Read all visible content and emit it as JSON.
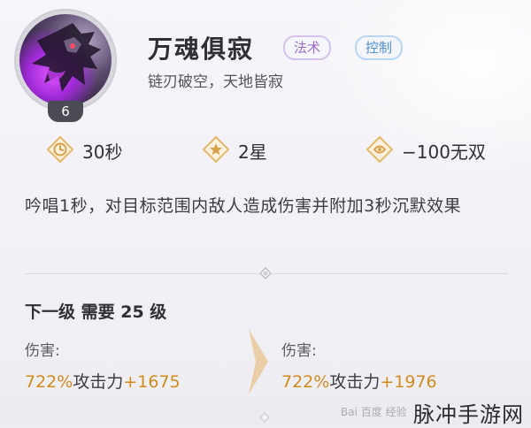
{
  "skill": {
    "name": "万魂俱寂",
    "subtitle": "链刃破空，天地皆寂",
    "level": "6",
    "tags": [
      "法术",
      "控制"
    ],
    "icon": "dragon-portrait-icon"
  },
  "stats": {
    "cooldown": "30秒",
    "stars": "2星",
    "cost": "−100无双"
  },
  "description": "吟唱1秒，对目标范围内敌人造成伤害并附加3秒沉默效果",
  "upgrade": {
    "next_level_text": "下一级 需要 25 级",
    "current": {
      "label": "伤害:",
      "percent": "722%",
      "mid": "攻击力",
      "bonus": "+1675"
    },
    "next": {
      "label": "伤害:",
      "percent": "722%",
      "mid": "攻击力",
      "bonus": "+1976"
    }
  },
  "watermark": {
    "text": "脉冲手游网",
    "baidu": "Bai 百度 经验"
  },
  "colors": {
    "accent_gold": "#d28a1d",
    "tag_magic": "#9a6bc8",
    "tag_control": "#4d8fd0"
  }
}
